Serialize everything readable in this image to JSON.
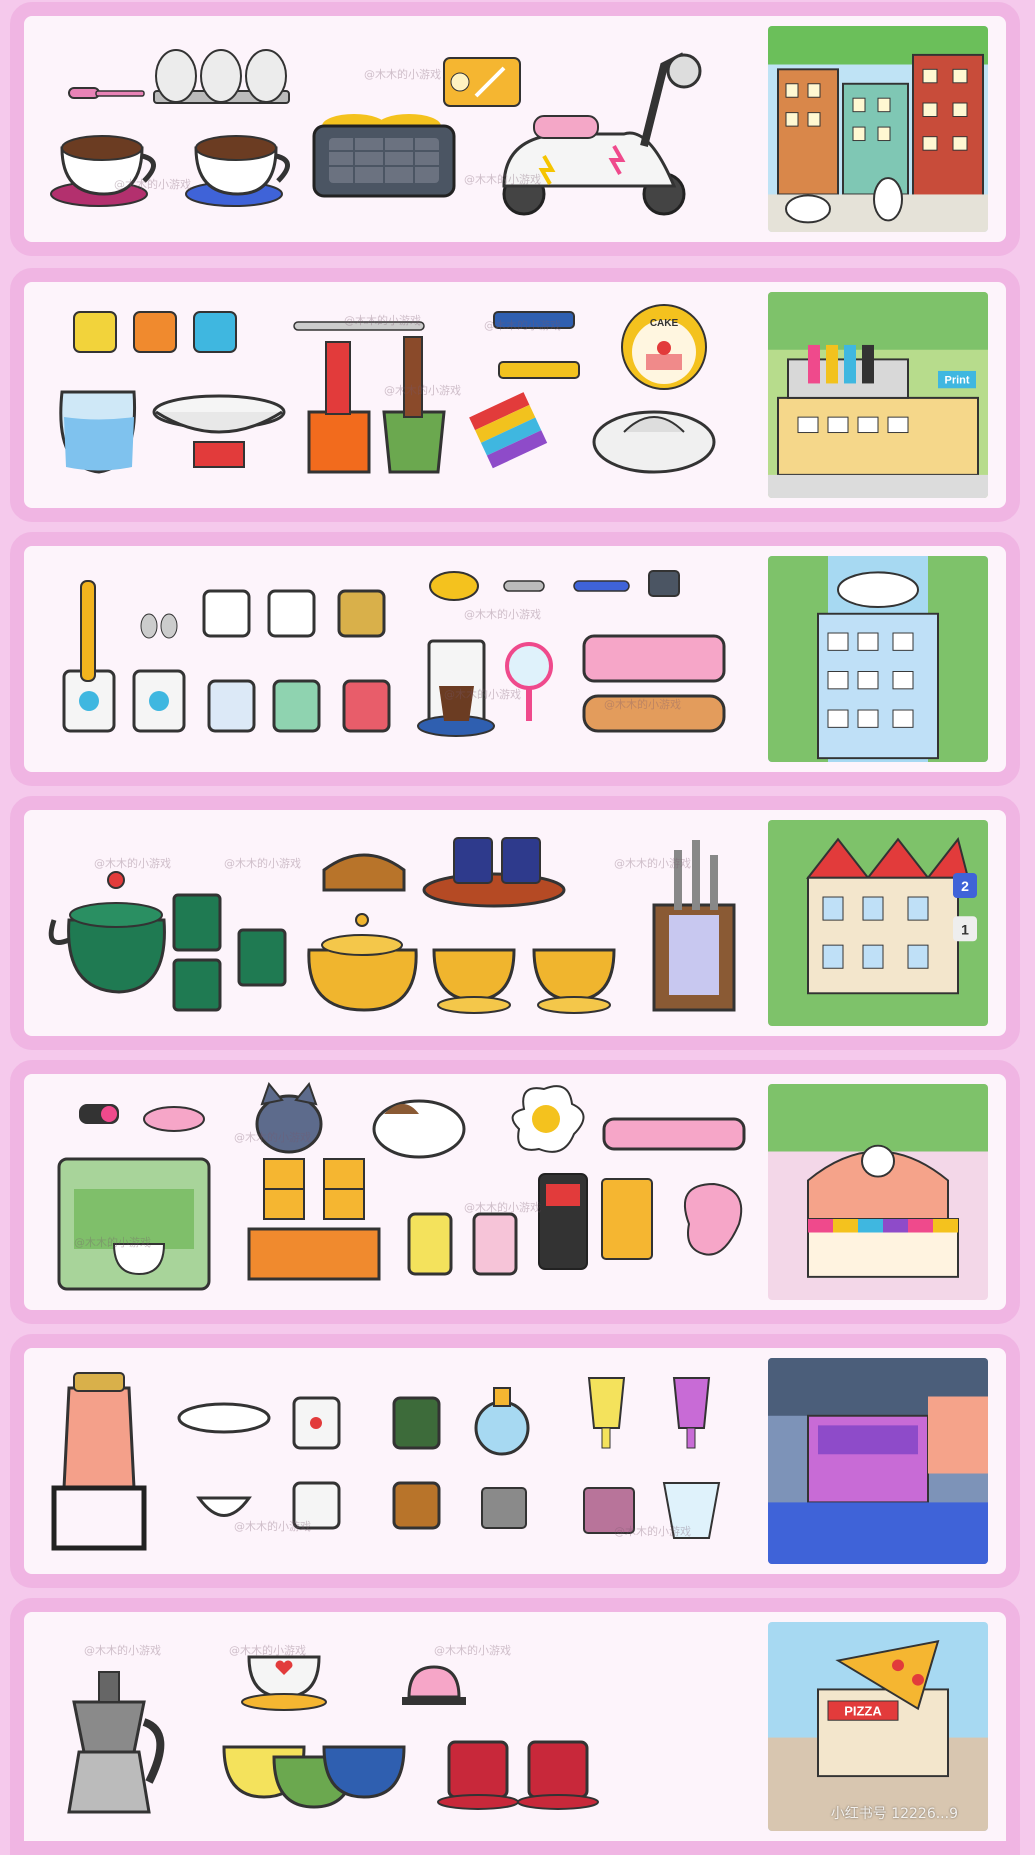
{
  "watermark": "@木木的小游戏",
  "corner_id": "小红书号 12226...9",
  "panels": [
    {
      "name": "city-row",
      "scene_labels": []
    },
    {
      "name": "print-shop-row",
      "scene_labels": [
        "Print"
      ],
      "item_labels": [
        "CAKE"
      ]
    },
    {
      "name": "apartment-row",
      "scene_labels": []
    },
    {
      "name": "villa-row",
      "scene_labels": [
        "2",
        "1"
      ]
    },
    {
      "name": "cat-cafe-row",
      "scene_labels": []
    },
    {
      "name": "market-row",
      "scene_labels": []
    },
    {
      "name": "pizza-row",
      "scene_labels": [
        "PIZZA"
      ]
    }
  ],
  "colors": {
    "background": "#f5c9ec",
    "panel_border": "#f0b5e3",
    "panel_fill": "#fdf4fb"
  }
}
